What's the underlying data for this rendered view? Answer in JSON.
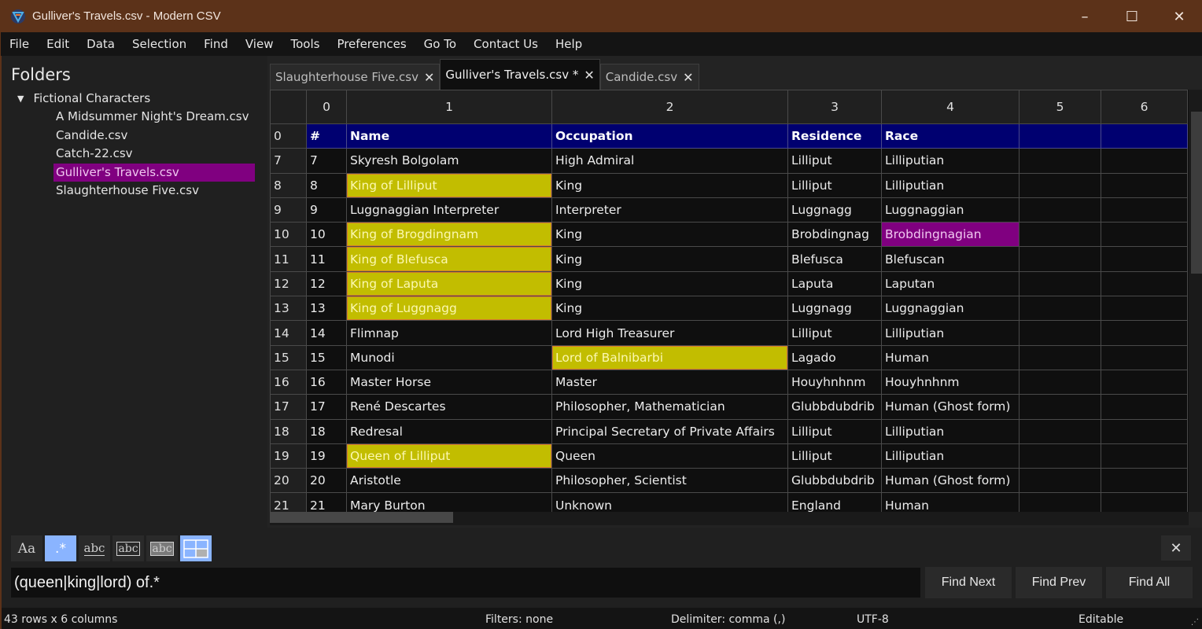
{
  "window": {
    "title": "Gulliver's Travels.csv - Modern CSV",
    "minimize_label": "–",
    "maximize_label": "☐",
    "close_label": "✕"
  },
  "menu": [
    "File",
    "Edit",
    "Data",
    "Selection",
    "Find",
    "View",
    "Tools",
    "Preferences",
    "Go To",
    "Contact Us",
    "Help"
  ],
  "sidebar": {
    "title": "Folders",
    "folder": {
      "label": "Fictional Characters",
      "expanded_icon": "▼"
    },
    "files": [
      {
        "label": "A Midsummer Night's Dream.csv",
        "selected": false
      },
      {
        "label": "Candide.csv",
        "selected": false
      },
      {
        "label": "Catch-22.csv",
        "selected": false
      },
      {
        "label": "Gulliver's Travels.csv",
        "selected": true
      },
      {
        "label": "Slaughterhouse Five.csv",
        "selected": false
      }
    ]
  },
  "tabs": [
    {
      "label": "Slaughterhouse Five.csv",
      "active": false,
      "close": "✕"
    },
    {
      "label": "Gulliver's Travels.csv *",
      "active": true,
      "close": "✕"
    },
    {
      "label": "Candide.csv",
      "active": false,
      "close": "✕"
    }
  ],
  "grid": {
    "column_headers": [
      "0",
      "1",
      "2",
      "3",
      "4",
      "5",
      "6"
    ],
    "header_row": {
      "row_index": "0",
      "cells": [
        "#",
        "Name",
        "Occupation",
        "Residence",
        "Race",
        "",
        ""
      ]
    },
    "rows": [
      {
        "row_index": "7",
        "cells": [
          "7",
          "Skyresh Bolgolam",
          "High Admiral",
          "Lilliput",
          "Lilliputian",
          "",
          ""
        ]
      },
      {
        "row_index": "8",
        "cells": [
          "8",
          "King of Lilliput",
          "King",
          "Lilliput",
          "Lilliputian",
          "",
          ""
        ],
        "match_cols": [
          1
        ]
      },
      {
        "row_index": "9",
        "cells": [
          "9",
          "Luggnaggian Interpreter",
          "Interpreter",
          "Luggnagg",
          "Luggnaggian",
          "",
          ""
        ]
      },
      {
        "row_index": "10",
        "cells": [
          "10",
          "King of Brogdingnam",
          "King",
          "Brobdingnag",
          "Brobdingnagian",
          "",
          ""
        ],
        "match_cols": [
          1
        ],
        "selected_cols": [
          4
        ]
      },
      {
        "row_index": "11",
        "cells": [
          "11",
          "King of Blefusca",
          "King",
          "Blefusca",
          "Blefuscan",
          "",
          ""
        ],
        "match_cols": [
          1
        ]
      },
      {
        "row_index": "12",
        "cells": [
          "12",
          "King of Laputa",
          "King",
          "Laputa",
          "Laputan",
          "",
          ""
        ],
        "match_cols": [
          1
        ]
      },
      {
        "row_index": "13",
        "cells": [
          "13",
          "King of Luggnagg",
          "King",
          "Luggnagg",
          "Luggnaggian",
          "",
          ""
        ],
        "match_cols": [
          1
        ]
      },
      {
        "row_index": "14",
        "cells": [
          "14",
          "Flimnap",
          "Lord High Treasurer",
          "Lilliput",
          "Lilliputian",
          "",
          ""
        ]
      },
      {
        "row_index": "15",
        "cells": [
          "15",
          "Munodi",
          "Lord of Balnibarbi",
          "Lagado",
          "Human",
          "",
          ""
        ],
        "match_cols": [
          2
        ]
      },
      {
        "row_index": "16",
        "cells": [
          "16",
          "Master Horse",
          "Master",
          "Houyhnhnm",
          "Houyhnhnm",
          "",
          ""
        ]
      },
      {
        "row_index": "17",
        "cells": [
          "17",
          "René Descartes",
          "Philosopher, Mathematician",
          "Glubbdubdrib",
          "Human (Ghost form)",
          "",
          ""
        ]
      },
      {
        "row_index": "18",
        "cells": [
          "18",
          "Redresal",
          "Principal Secretary of Private Affairs",
          "Lilliput",
          "Lilliputian",
          "",
          ""
        ]
      },
      {
        "row_index": "19",
        "cells": [
          "19",
          "Queen of Lilliput",
          "Queen",
          "Lilliput",
          "Lilliputian",
          "",
          ""
        ],
        "match_cols": [
          1
        ]
      },
      {
        "row_index": "20",
        "cells": [
          "20",
          "Aristotle",
          "Philosopher, Scientist",
          "Glubbdubdrib",
          "Human (Ghost form)",
          "",
          ""
        ]
      },
      {
        "row_index": "21",
        "cells": [
          "21",
          "Mary Burton",
          "Unknown",
          "England",
          "Human",
          "",
          ""
        ]
      }
    ]
  },
  "find": {
    "options": [
      {
        "name": "match-case",
        "label": "Aa",
        "active": false
      },
      {
        "name": "regex",
        "label": ".*",
        "active": true
      },
      {
        "name": "whole-word",
        "label": "abc",
        "active": false
      },
      {
        "name": "whole-cell",
        "label": "abc",
        "active": false
      },
      {
        "name": "in-selection",
        "label": "abc",
        "active": false
      },
      {
        "name": "highlight-matches",
        "label": "",
        "active": true
      }
    ],
    "query": "(queen|king|lord) of.*",
    "close_label": "✕",
    "buttons": {
      "next": "Find Next",
      "prev": "Find Prev",
      "all": "Find All"
    }
  },
  "status": {
    "dimensions": "43 rows x 6 columns",
    "filters": "Filters: none",
    "delimiter": "Delimiter: comma (,)",
    "encoding": "UTF-8",
    "mode": "Editable"
  },
  "colors": {
    "titlebar": "#5c3219",
    "header_row": "#000070",
    "match_highlight": "#c2bd00",
    "selection": "#800080",
    "toggle_active": "#8ab4ff"
  }
}
